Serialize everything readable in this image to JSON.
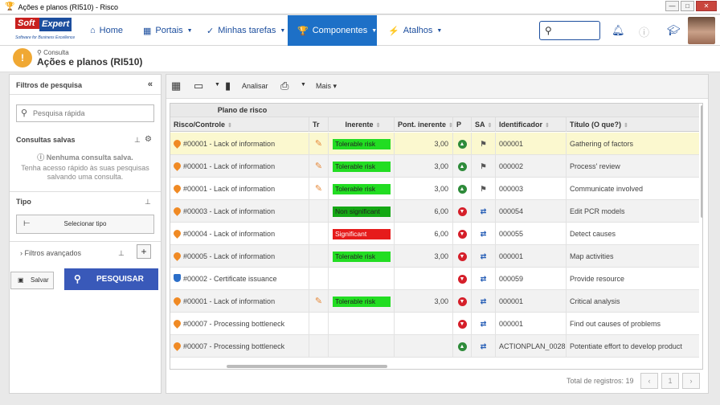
{
  "window": {
    "title": "Ações e planos (RI510) - Risco",
    "min": "—",
    "max": "□",
    "close": "✕"
  },
  "brand": {
    "logo_part1": "Soft",
    "logo_part2": "Expert",
    "tagline": "Software for Business Excellence"
  },
  "nav": {
    "items": [
      {
        "label": "Home",
        "icon": "⌂"
      },
      {
        "label": "Portais",
        "icon": "▦"
      },
      {
        "label": "Minhas tarefas",
        "icon": "✓"
      },
      {
        "label": "Componentes",
        "icon": "🏆"
      },
      {
        "label": "Atalhos",
        "icon": "⚡"
      }
    ]
  },
  "header": {
    "crumb": "Consulta",
    "title": "Ações e planos (RI510)"
  },
  "filters": {
    "title": "Filtros de pesquisa",
    "quick_search_placeholder": "Pesquisa rápida",
    "saved_title": "Consultas salvas",
    "saved_empty_title": "Nenhuma consulta salva.",
    "saved_empty_hint": "Tenha acesso rápido às suas pesquisas salvando uma consulta.",
    "type_title": "Tipo",
    "select_type": "Selecionar tipo",
    "advanced": "Filtros avançados",
    "save": "Salvar",
    "search": "PESQUISAR"
  },
  "toolbar": {
    "analyze": "Analisar",
    "more": "Mais"
  },
  "grid": {
    "group_header": "Plano de risco",
    "columns": [
      "Risco/Controle",
      "Tr",
      "Inerente",
      "Pont. inerente",
      "P",
      "SA",
      "Identificador",
      "Título (O que?)"
    ],
    "rows": [
      {
        "risk": "#00001 - Lack of information",
        "kind": "risk",
        "tr": true,
        "inerente": "Tolerable risk",
        "lvl": "green",
        "score": "3,00",
        "p": "up",
        "sa": "flag",
        "id": "000001",
        "title": "Gathering of factors"
      },
      {
        "risk": "#00001 - Lack of information",
        "kind": "risk",
        "tr": true,
        "inerente": "Tolerable risk",
        "lvl": "green",
        "score": "3,00",
        "p": "up",
        "sa": "flag",
        "id": "000002",
        "title": "Process' review"
      },
      {
        "risk": "#00001 - Lack of information",
        "kind": "risk",
        "tr": true,
        "inerente": "Tolerable risk",
        "lvl": "green",
        "score": "3,00",
        "p": "up",
        "sa": "flag",
        "id": "000003",
        "title": "Communicate involved"
      },
      {
        "risk": "#00003 - Lack of information",
        "kind": "risk",
        "tr": false,
        "inerente": "Non significant",
        "lvl": "dgreen",
        "score": "6,00",
        "p": "down",
        "sa": "arrows",
        "id": "000054",
        "title": "Edit PCR models"
      },
      {
        "risk": "#00004 - Lack of information",
        "kind": "risk",
        "tr": false,
        "inerente": "Significant",
        "lvl": "red",
        "score": "6,00",
        "p": "down",
        "sa": "arrows",
        "id": "000055",
        "title": "Detect causes"
      },
      {
        "risk": "#00005 - Lack of information",
        "kind": "risk",
        "tr": false,
        "inerente": "Tolerable risk",
        "lvl": "green",
        "score": "3,00",
        "p": "down",
        "sa": "arrows",
        "id": "000001",
        "title": "Map activities"
      },
      {
        "risk": "#00002 - Certificate issuance",
        "kind": "control",
        "tr": false,
        "inerente": "",
        "lvl": "",
        "score": "",
        "p": "down",
        "sa": "arrows",
        "id": "000059",
        "title": "Provide resource"
      },
      {
        "risk": "#00001 - Lack of information",
        "kind": "risk",
        "tr": true,
        "inerente": "Tolerable risk",
        "lvl": "green",
        "score": "3,00",
        "p": "down",
        "sa": "arrows",
        "id": "000001",
        "title": "Critical analysis"
      },
      {
        "risk": "#00007 - Processing bottleneck",
        "kind": "risk",
        "tr": false,
        "inerente": "",
        "lvl": "",
        "score": "",
        "p": "down",
        "sa": "arrows",
        "id": "000001",
        "title": "Find out causes of problems"
      },
      {
        "risk": "#00007 - Processing bottleneck",
        "kind": "risk",
        "tr": false,
        "inerente": "",
        "lvl": "",
        "score": "",
        "p": "up",
        "sa": "arrows",
        "id": "ACTIONPLAN_0028",
        "title": "Potentiate effort to develop product"
      }
    ]
  },
  "footer": {
    "total": "Total de registros: 19",
    "page": "1"
  }
}
